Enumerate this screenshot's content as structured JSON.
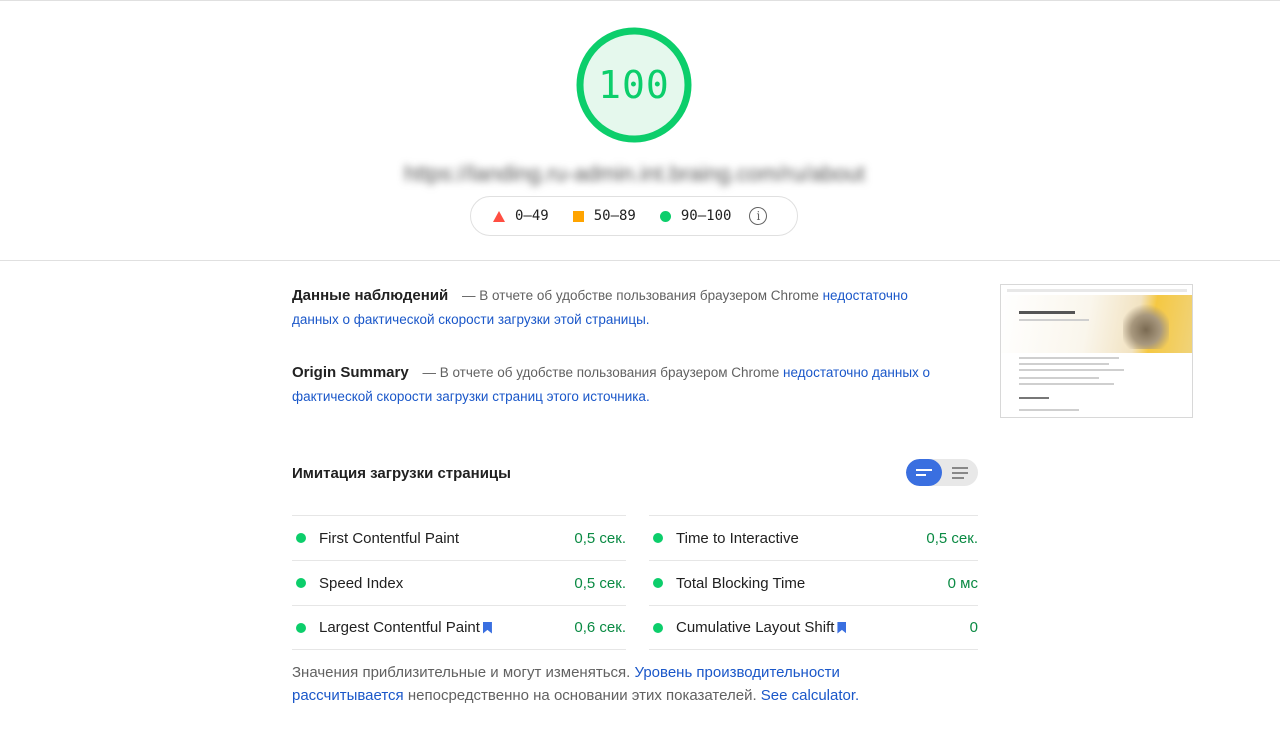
{
  "score": {
    "value": "100",
    "color": "#0cce6b"
  },
  "url": "https://landing.ru-admin.int.braing.com/ru/about",
  "legend": {
    "items": [
      {
        "icon": "red-triangle-icon",
        "range": "0–49",
        "color": "#ff4e42"
      },
      {
        "icon": "orange-square-icon",
        "range": "50–89",
        "color": "#ffa400"
      },
      {
        "icon": "green-circle-icon",
        "range": "90–100",
        "color": "#0cce6b"
      }
    ],
    "info_icon": "i"
  },
  "field_data": {
    "title": "Данные наблюдений",
    "text": "— В отчете об удобстве пользования браузером Chrome",
    "link": "недостаточно данных о фактической скорости загрузки этой страницы."
  },
  "origin_summary": {
    "title": "Origin Summary",
    "text": "— В отчете об удобстве пользования браузером Chrome",
    "link": "недостаточно данных о фактической скорости загрузки страниц этого источника."
  },
  "simulation": {
    "title": "Имитация загрузки страницы",
    "view_toggle": {
      "selected": "summary-view"
    }
  },
  "metrics_left": [
    {
      "label": "First Contentful Paint",
      "value": "0,5 сек.",
      "bookmark": false
    },
    {
      "label": "Speed Index",
      "value": "0,5 сек.",
      "bookmark": false
    },
    {
      "label": "Largest Contentful Paint",
      "value": "0,6 сек.",
      "bookmark": true
    }
  ],
  "metrics_right": [
    {
      "label": "Time to Interactive",
      "value": "0,5 сек.",
      "bookmark": false
    },
    {
      "label": "Total Blocking Time",
      "value": "0 мс",
      "bookmark": false
    },
    {
      "label": "Cumulative Layout Shift",
      "value": "0",
      "bookmark": true
    }
  ],
  "footnote": {
    "text1": "Значения приблизительные и могут изменяться.",
    "link1": "Уровень производительности рассчитывается",
    "text2": "непосредственно на основании этих показателей.",
    "link2": "See calculator."
  }
}
